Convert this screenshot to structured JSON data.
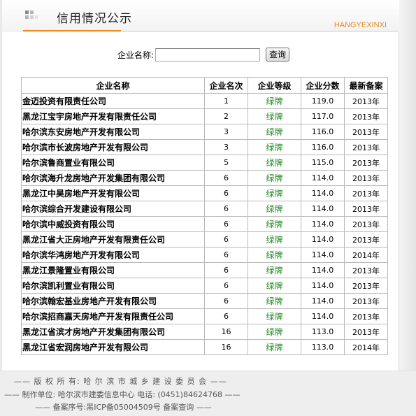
{
  "header": {
    "title": "信用情况公示",
    "subtitle": "HANGYEXINXI",
    "icon": "grid-icon"
  },
  "search": {
    "label": "企业名称:",
    "value": "",
    "button": "查询"
  },
  "table": {
    "columns": [
      "企业名称",
      "企业名次",
      "企业等级",
      "企业分数",
      "最新备案"
    ],
    "rows": [
      {
        "name": "金迈投资有限责任公司",
        "rank": "1",
        "grade": "绿牌",
        "score": "119.0",
        "year": "2013年"
      },
      {
        "name": "黑龙江宝宇房地产开发有限责任公司",
        "rank": "2",
        "grade": "绿牌",
        "score": "117.0",
        "year": "2013年"
      },
      {
        "name": "哈尔滨东安房地产开发有限公司",
        "rank": "3",
        "grade": "绿牌",
        "score": "116.0",
        "year": "2013年"
      },
      {
        "name": "哈尔滨市长波房地产开发有限公司",
        "rank": "3",
        "grade": "绿牌",
        "score": "116.0",
        "year": "2013年"
      },
      {
        "name": "哈尔滨鲁商置业有限公司",
        "rank": "5",
        "grade": "绿牌",
        "score": "115.0",
        "year": "2013年"
      },
      {
        "name": "哈尔滨海升龙房地产开发集团有限公司",
        "rank": "6",
        "grade": "绿牌",
        "score": "114.0",
        "year": "2013年"
      },
      {
        "name": "黑龙江中昊房地产开发有限公司",
        "rank": "6",
        "grade": "绿牌",
        "score": "114.0",
        "year": "2013年"
      },
      {
        "name": "哈尔滨综合开发建设有限公司",
        "rank": "6",
        "grade": "绿牌",
        "score": "114.0",
        "year": "2013年"
      },
      {
        "name": "哈尔滨中威投资有限公司",
        "rank": "6",
        "grade": "绿牌",
        "score": "114.0",
        "year": "2013年"
      },
      {
        "name": "黑龙江省大正房地产开发有限责任公司",
        "rank": "6",
        "grade": "绿牌",
        "score": "114.0",
        "year": "2013年"
      },
      {
        "name": "哈尔滨华鸿房地产开发有限公司",
        "rank": "6",
        "grade": "绿牌",
        "score": "114.0",
        "year": "2014年"
      },
      {
        "name": "黑龙江景隆置业有限公司",
        "rank": "6",
        "grade": "绿牌",
        "score": "114.0",
        "year": "2013年"
      },
      {
        "name": "哈尔滨凯利置业有限公司",
        "rank": "6",
        "grade": "绿牌",
        "score": "114.0",
        "year": "2013年"
      },
      {
        "name": "哈尔滨翰宏基业房地产开发有限公司",
        "rank": "6",
        "grade": "绿牌",
        "score": "114.0",
        "year": "2013年"
      },
      {
        "name": "哈尔滨招商嘉天房地产开发有限责任公司",
        "rank": "6",
        "grade": "绿牌",
        "score": "114.0",
        "year": "2013年"
      },
      {
        "name": "黑龙江省滨才房地产开发集团有限公司",
        "rank": "16",
        "grade": "绿牌",
        "score": "113.0",
        "year": "2013年"
      },
      {
        "name": "黑龙江省宏润房地产开发有限公司",
        "rank": "16",
        "grade": "绿牌",
        "score": "113.0",
        "year": "2014年"
      }
    ]
  },
  "footer": {
    "line1": "—— 版 权 所 有: 哈 尔 滨 市 城 乡 建 设 委 员 会 ——",
    "line2": "—— 制作单位: 哈尔滨市建委信息中心 电话: (0451)84624768 ——",
    "line3": "—— 备案序号:黑ICP备05004509号 备案查询 ——"
  },
  "colors": {
    "accent": "#f08a1c",
    "grade_green": "#228b22",
    "footer_bg": "#eeeeee"
  }
}
